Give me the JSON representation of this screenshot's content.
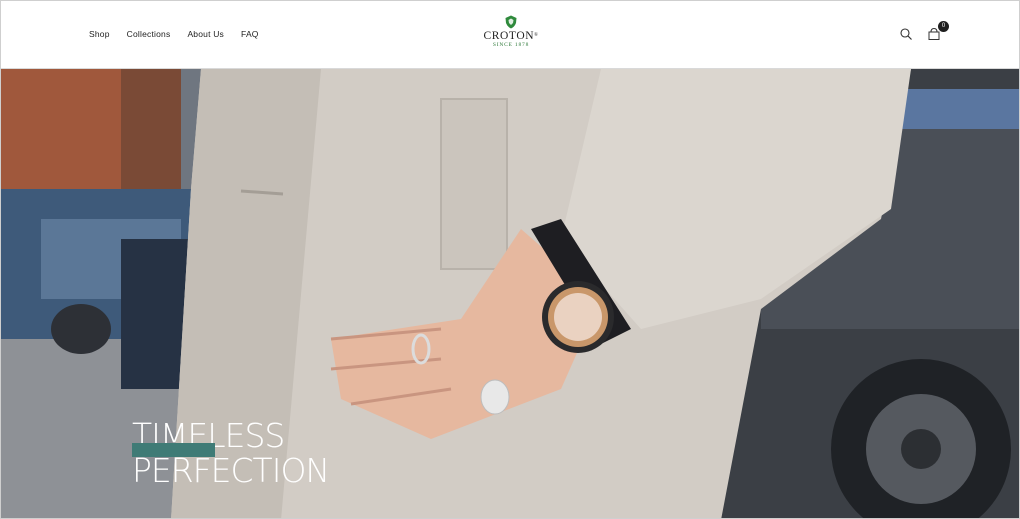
{
  "nav": {
    "items": [
      {
        "label": "Shop"
      },
      {
        "label": "Collections"
      },
      {
        "label": "About Us"
      },
      {
        "label": "FAQ"
      }
    ]
  },
  "logo": {
    "wordmark": "CROTON",
    "registered": "®",
    "tagline": "SINCE 1878",
    "emblem_color": "#2f8a3c"
  },
  "header_icons": {
    "search": "search-icon",
    "cart": "cart-icon",
    "cart_count": "0"
  },
  "hero": {
    "title_line1": "TIMELESS",
    "title_line2": "PERFECTION",
    "cta_color": "#3f7b76"
  }
}
